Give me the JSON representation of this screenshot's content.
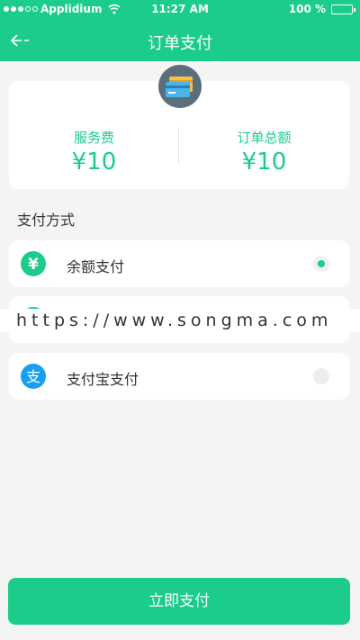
{
  "status_bar": {
    "carrier": "Applidium",
    "time": "11:27 AM",
    "battery": "100 %",
    "battery_level": 1.0
  },
  "nav": {
    "title": "订单支付",
    "back_icon": "back-arrow-icon"
  },
  "summary": {
    "badge_icon": "credit-card-icon",
    "service_fee_label": "服务费",
    "service_fee_value": "¥10",
    "order_total_label": "订单总额",
    "order_total_value": "¥10"
  },
  "payment": {
    "section_title": "支付方式",
    "options": [
      {
        "label": "余额支付",
        "icon": "yuan-icon",
        "selected": true
      },
      {
        "label": "",
        "icon": "wechat-icon",
        "selected": false
      },
      {
        "label": "支付宝支付",
        "icon": "alipay-icon",
        "selected": false
      }
    ]
  },
  "watermark": "https://www.songma.com",
  "pay_button_label": "立即支付",
  "colors": {
    "accent": "#1ccc8b",
    "alipay": "#1a9ef0",
    "badge": "#5c6e7c"
  }
}
